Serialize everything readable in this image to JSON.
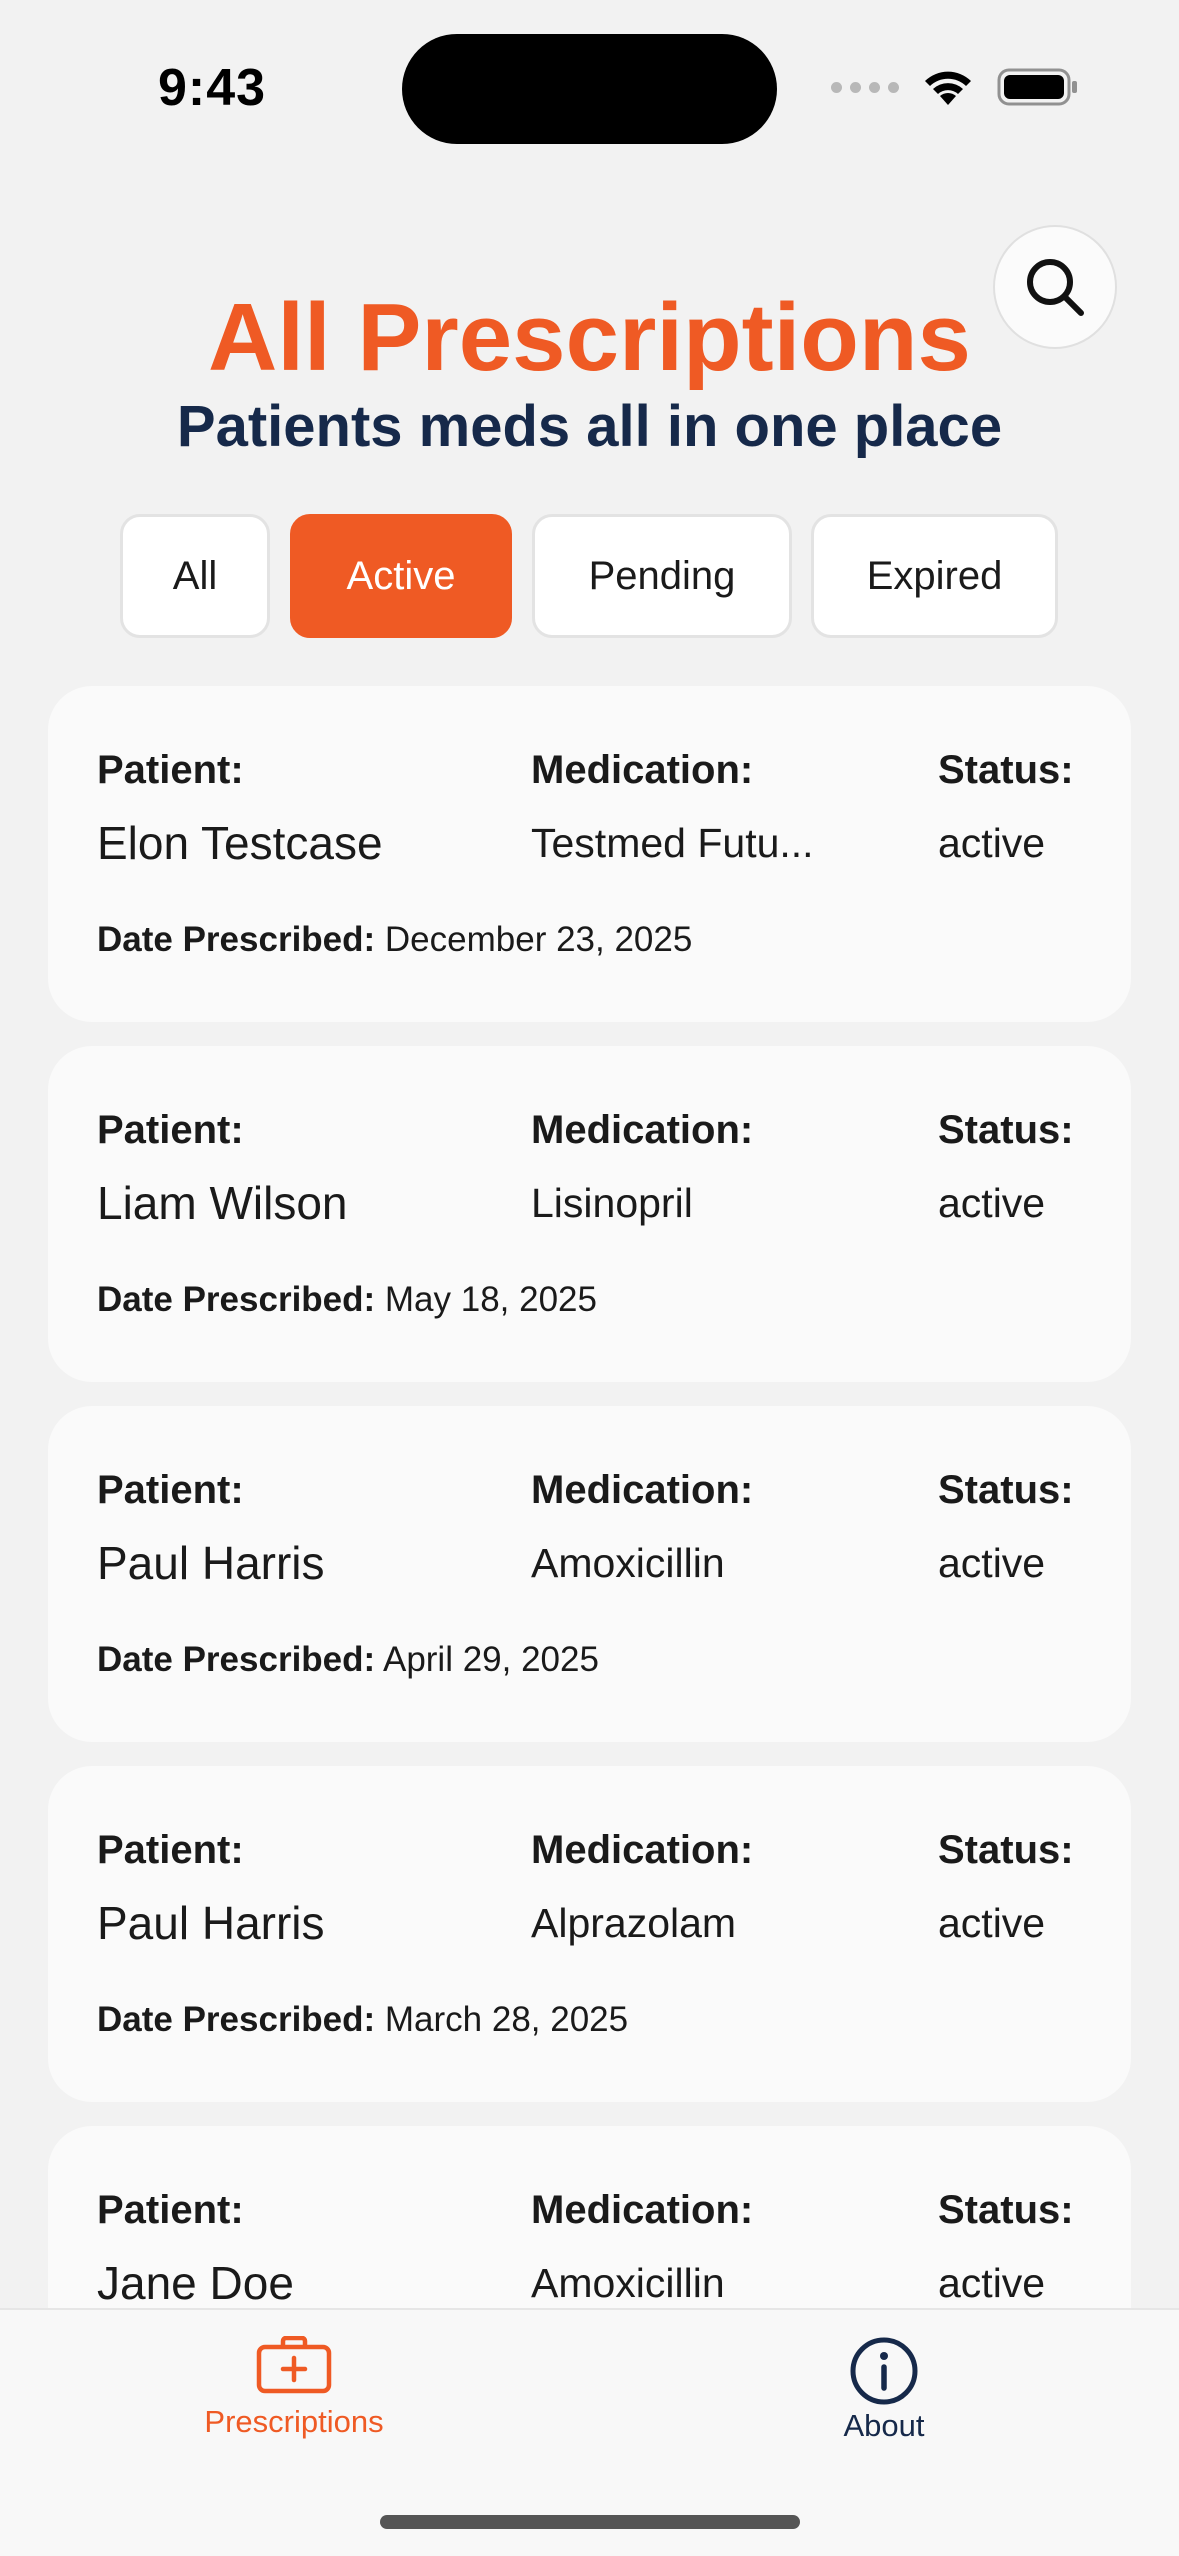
{
  "status_bar": {
    "time": "9:43"
  },
  "header": {
    "title": "All Prescriptions",
    "subtitle": "Patients meds all in one place"
  },
  "filters": [
    {
      "label": "All",
      "selected": false
    },
    {
      "label": "Active",
      "selected": true
    },
    {
      "label": "Pending",
      "selected": false
    },
    {
      "label": "Expired",
      "selected": false
    }
  ],
  "labels": {
    "patient": "Patient:",
    "medication": "Medication:",
    "status": "Status:",
    "date_prescribed": "Date Prescribed:"
  },
  "prescriptions": [
    {
      "patient": "Elon Testcase",
      "medication": "Testmed Futu...",
      "status": "active",
      "date": "December 23, 2025"
    },
    {
      "patient": "Liam Wilson",
      "medication": "Lisinopril",
      "status": "active",
      "date": "May 18, 2025"
    },
    {
      "patient": "Paul Harris",
      "medication": "Amoxicillin",
      "status": "active",
      "date": "April 29, 2025"
    },
    {
      "patient": "Paul Harris",
      "medication": "Alprazolam",
      "status": "active",
      "date": "March 28, 2025"
    },
    {
      "patient": "Jane Doe",
      "medication": "Amoxicillin",
      "status": "active",
      "date": ""
    }
  ],
  "tabbar": {
    "prescriptions_label": "Prescriptions",
    "about_label": "About"
  },
  "colors": {
    "accent": "#ef5a24",
    "navy": "#16294a",
    "background": "#f2f2f2",
    "card": "#fafafa"
  },
  "icons": {
    "search": "search-icon",
    "prescriptions_tab": "medical-kit-icon",
    "about_tab": "info-circle-icon"
  }
}
